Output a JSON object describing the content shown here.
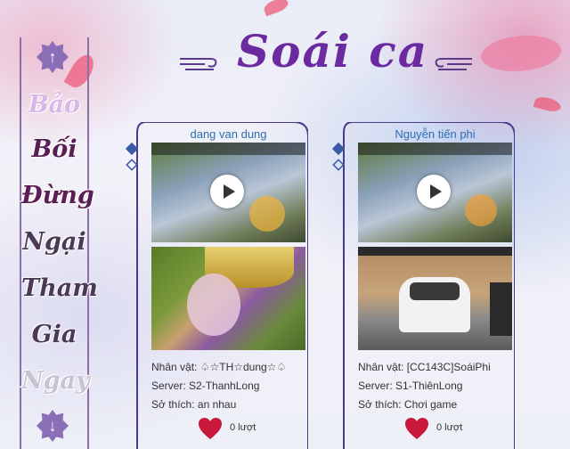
{
  "sidebar": {
    "up_icon": "↑",
    "down_icon": "↓",
    "words": [
      "Bảo",
      "Bối",
      "Đừng",
      "Ngại",
      "Tham",
      "Gia",
      "Ngay"
    ]
  },
  "header": {
    "title": "Soái ca"
  },
  "cards": [
    {
      "name": "dang van dung",
      "character_label": "Nhân vật:",
      "character": "♤☆TH☆dung☆♤",
      "server_label": "Server:",
      "server": "S2-ThanhLong",
      "hobby_label": "Sở thích:",
      "hobby": "an nhau",
      "likes": "0 lượt"
    },
    {
      "name": "Nguyễn tiến phi",
      "character_label": "Nhân vật:",
      "character": "[CC143C]SoáiPhi",
      "server_label": "Server:",
      "server": "S1-ThiênLong",
      "hobby_label": "Sở thích:",
      "hobby": "Chơi game",
      "likes": "0 lượt"
    }
  ],
  "colors": {
    "frame": "#4a3a8e",
    "name": "#2e6db2",
    "heart": "#c8193c",
    "nav": "#8a6fb6"
  }
}
